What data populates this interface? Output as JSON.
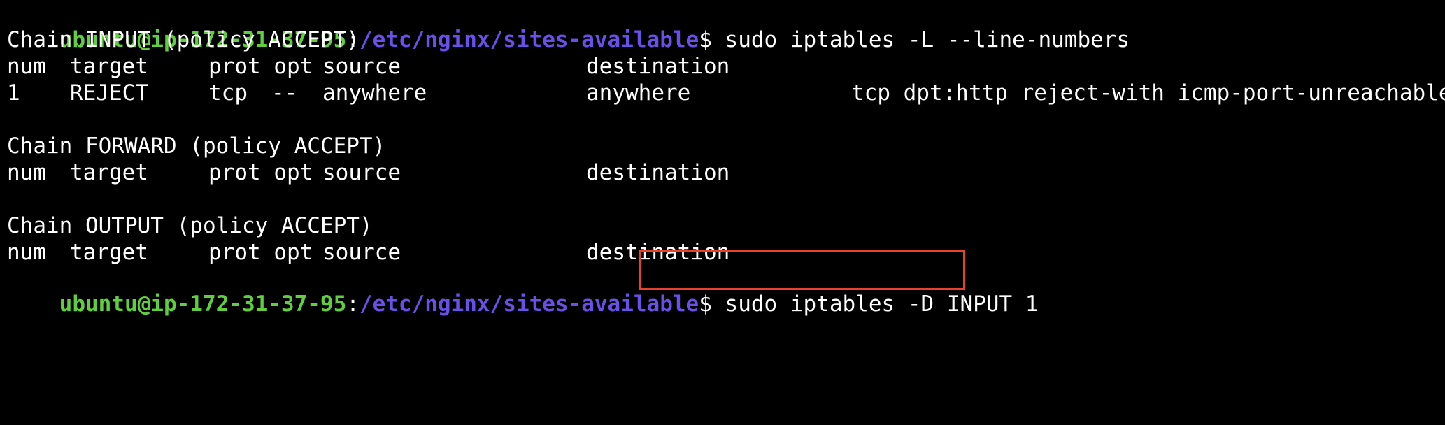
{
  "prompt": {
    "user_host": "ubuntu@ip-172-31-37-95",
    "colon": ":",
    "path": "/etc/nginx/sites-available",
    "symbol": "$"
  },
  "commands": {
    "first": " sudo iptables -L --line-numbers",
    "second": " sudo iptables -D INPUT 1"
  },
  "chains": [
    {
      "title": "Chain INPUT (policy ACCEPT)"
    },
    {
      "title": "Chain FORWARD (policy ACCEPT)"
    },
    {
      "title": "Chain OUTPUT (policy ACCEPT)"
    }
  ],
  "headers": {
    "num": "num",
    "target": "target",
    "prot_opt": "prot opt",
    "source": "source",
    "destination": "destination"
  },
  "rule": {
    "num": "1",
    "target": "REJECT",
    "prot": "tcp",
    "opt": "--",
    "source": "anywhere",
    "destination": "anywhere",
    "extra": "tcp dpt:http reject-with icmp-port-unreachable"
  },
  "colors": {
    "user_host": "#5fcf3f",
    "path": "#6a4fe8",
    "highlight_border": "#e8422c"
  }
}
